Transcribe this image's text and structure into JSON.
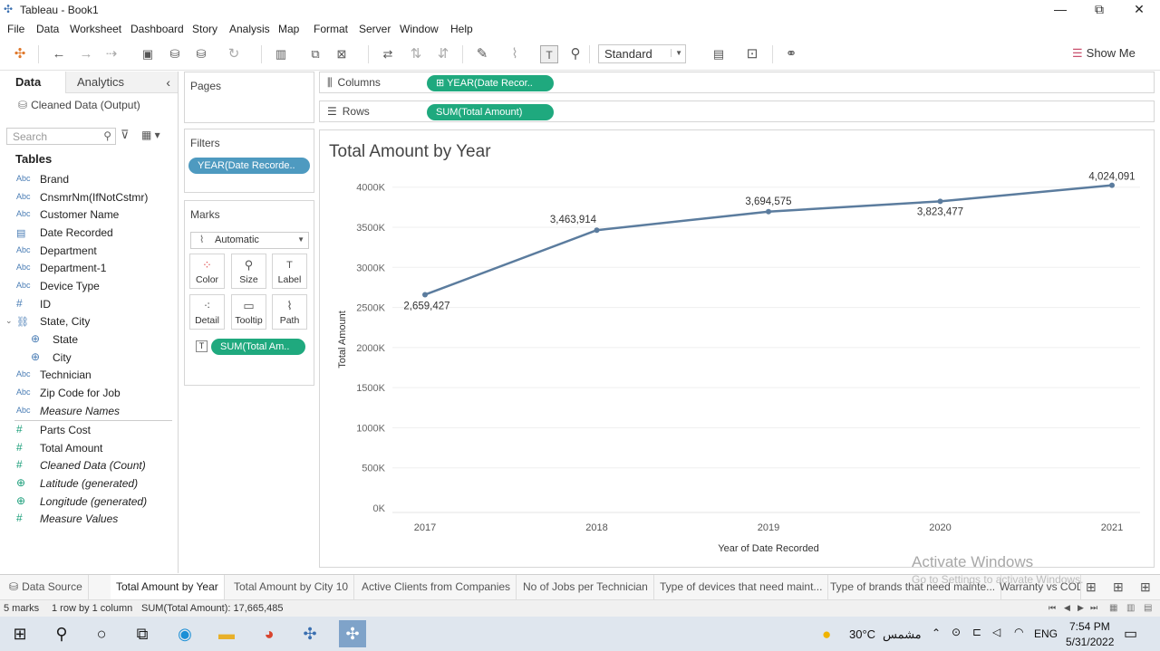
{
  "window": {
    "title": "Tableau - Book1",
    "minimize": "—",
    "restore": "⧉",
    "close": "✕"
  },
  "menu": [
    "File",
    "Data",
    "Worksheet",
    "Dashboard",
    "Story",
    "Analysis",
    "Map",
    "Format",
    "Server",
    "Window",
    "Help"
  ],
  "toolbar": {
    "fit_select": "Standard",
    "show_me": "Show Me"
  },
  "left_pane": {
    "tab_data": "Data",
    "tab_analytics": "Analytics",
    "collapse": "‹",
    "datasource": "Cleaned Data (Output)",
    "search_placeholder": "Search",
    "tables_heading": "Tables",
    "dimensions": [
      {
        "type": "Abc",
        "name": "Brand"
      },
      {
        "type": "Abc",
        "name": "CnsmrNm(IfNotCstmr)"
      },
      {
        "type": "Abc",
        "name": "Customer Name"
      },
      {
        "type": "date",
        "name": "Date Recorded"
      },
      {
        "type": "Abc",
        "name": "Department"
      },
      {
        "type": "Abc",
        "name": "Department-1"
      },
      {
        "type": "Abc",
        "name": "Device Type"
      },
      {
        "type": "#",
        "name": "ID"
      },
      {
        "type": "hier",
        "name": "State, City"
      },
      {
        "type": "geo",
        "name": "State"
      },
      {
        "type": "geo",
        "name": "City"
      },
      {
        "type": "Abc",
        "name": "Technician"
      },
      {
        "type": "Abc",
        "name": "Zip Code for Job"
      },
      {
        "type": "Abc",
        "name": "Measure Names"
      }
    ],
    "measures": [
      {
        "type": "#",
        "name": "Parts Cost"
      },
      {
        "type": "#",
        "name": "Total Amount"
      },
      {
        "type": "=#",
        "name": "Cleaned Data (Count)"
      },
      {
        "type": "geo",
        "name": "Latitude (generated)"
      },
      {
        "type": "geo",
        "name": "Longitude (generated)"
      },
      {
        "type": "#",
        "name": "Measure Values"
      }
    ]
  },
  "cards": {
    "pages": "Pages",
    "filters": "Filters",
    "filter_pill": "YEAR(Date Recorde..",
    "marks": "Marks",
    "mark_type": "Automatic",
    "mark_buttons": [
      "Color",
      "Size",
      "Label",
      "Detail",
      "Tooltip",
      "Path"
    ],
    "marks_pill": "SUM(Total Am.."
  },
  "shelves": {
    "columns_label": "Columns",
    "columns_pill": "⊞ YEAR(Date Recor..",
    "rows_label": "Rows",
    "rows_pill": "SUM(Total Amount)"
  },
  "chart_data": {
    "type": "line",
    "title": "Total Amount by Year",
    "xlabel": "Year of Date Recorded",
    "ylabel": "Total Amount",
    "categories": [
      "2017",
      "2018",
      "2019",
      "2020",
      "2021"
    ],
    "values": [
      2659427,
      3463914,
      3694575,
      3823477,
      4024091
    ],
    "data_labels": [
      "2,659,427",
      "3,463,914",
      "3,694,575",
      "3,823,477",
      "4,024,091"
    ],
    "yticks": [
      0,
      500000,
      1000000,
      1500000,
      2000000,
      2500000,
      3000000,
      3500000,
      4000000
    ],
    "ytick_labels": [
      "0K",
      "500K",
      "1000K",
      "1500K",
      "2000K",
      "2500K",
      "3000K",
      "3500K",
      "4000K"
    ],
    "ylim": [
      0,
      4200000
    ],
    "line_color": "#5b7c9e",
    "grid": true
  },
  "bottom_tabs": [
    "Data Source",
    "Total Amount by Year",
    "Total Amount by City 10",
    "Active Clients from Companies",
    "No of Jobs per Technician",
    "Type of devices that need maint...",
    "Type of brands that need mainte...",
    "Warranty vs COD"
  ],
  "status": {
    "marks": "5 marks",
    "layout": "1 row by 1 column",
    "sum": "SUM(Total Amount): 17,665,485"
  },
  "watermark": {
    "line1": "Activate Windows",
    "line2": "Go to Settings to activate Windows."
  },
  "taskbar": {
    "weather": "30°C",
    "weather_text": "مشمس",
    "lang": "ENG",
    "time": "7:54 PM",
    "date": "5/31/2022"
  },
  "colors": {
    "accent_green": "#1fa97e",
    "filter_blue": "#4e9ac0"
  }
}
